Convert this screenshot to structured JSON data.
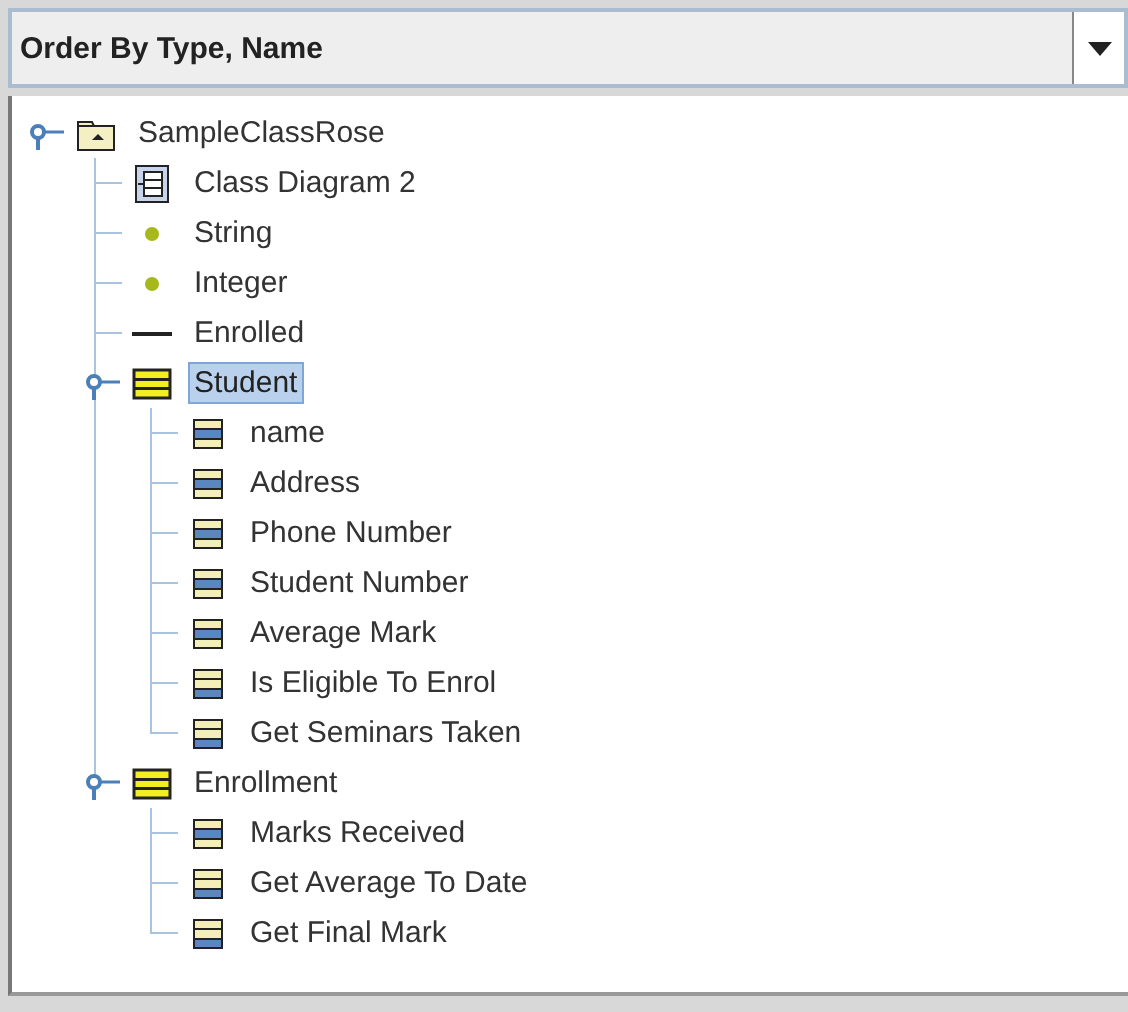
{
  "order_dropdown": {
    "value": "Order By Type, Name"
  },
  "tree": [
    {
      "label": "SampleClassRose",
      "kind": "package",
      "selected": false,
      "expanded": true,
      "children": [
        {
          "label": "Class Diagram 2",
          "kind": "diagram",
          "selected": false
        },
        {
          "label": "String",
          "kind": "datatype",
          "selected": false
        },
        {
          "label": "Integer",
          "kind": "datatype",
          "selected": false
        },
        {
          "label": "Enrolled",
          "kind": "association",
          "selected": false
        },
        {
          "label": "Student",
          "kind": "class",
          "selected": true,
          "expanded": true,
          "children": [
            {
              "label": "name",
              "kind": "attribute",
              "selected": false
            },
            {
              "label": "Address",
              "kind": "attribute",
              "selected": false
            },
            {
              "label": "Phone Number",
              "kind": "attribute",
              "selected": false
            },
            {
              "label": "Student Number",
              "kind": "attribute",
              "selected": false
            },
            {
              "label": "Average Mark",
              "kind": "attribute",
              "selected": false
            },
            {
              "label": "Is Eligible To Enrol",
              "kind": "operation",
              "selected": false
            },
            {
              "label": "Get Seminars Taken",
              "kind": "operation",
              "selected": false
            }
          ]
        },
        {
          "label": "Enrollment",
          "kind": "class",
          "selected": false,
          "expanded": true,
          "children": [
            {
              "label": "Marks Received",
              "kind": "attribute",
              "selected": false
            },
            {
              "label": "Get Average To Date",
              "kind": "operation",
              "selected": false
            },
            {
              "label": "Get Final Mark",
              "kind": "operation",
              "selected": false
            }
          ]
        }
      ]
    }
  ]
}
